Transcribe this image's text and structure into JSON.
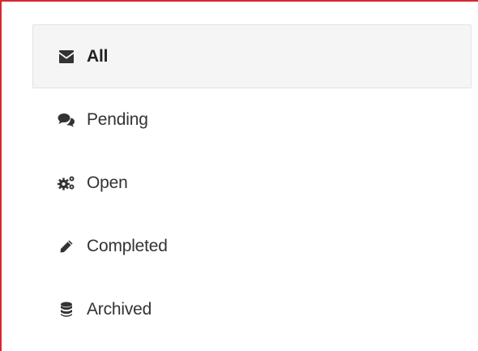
{
  "colors": {
    "frame_accent": "#d9272e",
    "active_bg": "#f5f5f5",
    "text": "#333333"
  },
  "nav": {
    "items": [
      {
        "label": "All",
        "icon": "envelope-icon",
        "active": true
      },
      {
        "label": "Pending",
        "icon": "comments-icon",
        "active": false
      },
      {
        "label": "Open",
        "icon": "cogs-icon",
        "active": false
      },
      {
        "label": "Completed",
        "icon": "pencil-icon",
        "active": false
      },
      {
        "label": "Archived",
        "icon": "database-icon",
        "active": false
      }
    ]
  }
}
